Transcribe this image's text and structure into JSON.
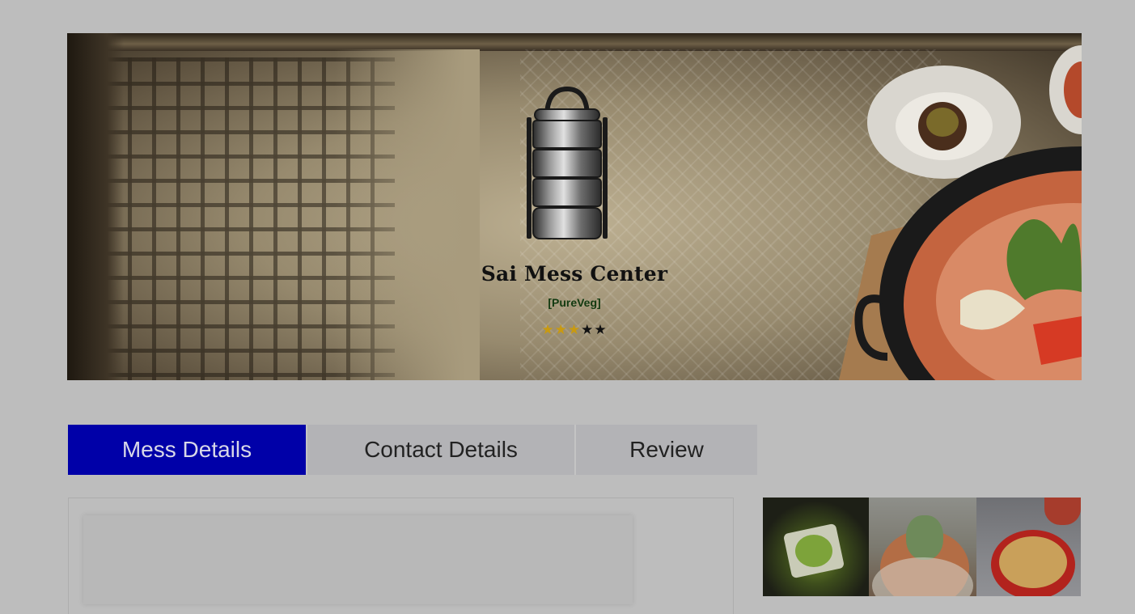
{
  "banner": {
    "mess_name": "Sai Mess Center",
    "mess_type": "[PureVeg]",
    "rating": {
      "filled": 3,
      "total": 5,
      "filled_star": "★★★",
      "empty_star": "★★"
    },
    "icon": "tiffin-box-icon"
  },
  "tabs": [
    {
      "label": "Mess Details",
      "active": true
    },
    {
      "label": "Contact Details",
      "active": false
    },
    {
      "label": "Review",
      "active": false
    }
  ],
  "colors": {
    "page_background": "#bdbdbd",
    "active_tab": "#0000a8",
    "inactive_tab": "#b3b3b6",
    "star_filled": "#c99a10",
    "star_empty": "#111111",
    "mess_type_text": "#123a10"
  }
}
